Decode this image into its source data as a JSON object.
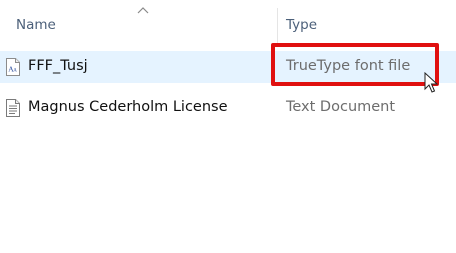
{
  "columns": {
    "name": "Name",
    "type": "Type"
  },
  "sort": {
    "icon": "sort-up-chevron-icon",
    "column": "Name"
  },
  "files": [
    {
      "name": "FFF_Tusj",
      "type": "TrueType font file",
      "icon": "font-file-icon",
      "selected": true
    },
    {
      "name": "Magnus Cederholm License",
      "type": "Text Document",
      "icon": "text-document-icon",
      "selected": false
    }
  ],
  "annotation": {
    "color": "#e01010",
    "target": "TrueType font file"
  },
  "colors": {
    "selection_bg": "#e5f3ff",
    "header_text": "#4c607a",
    "type_text": "#6d6d6d"
  }
}
